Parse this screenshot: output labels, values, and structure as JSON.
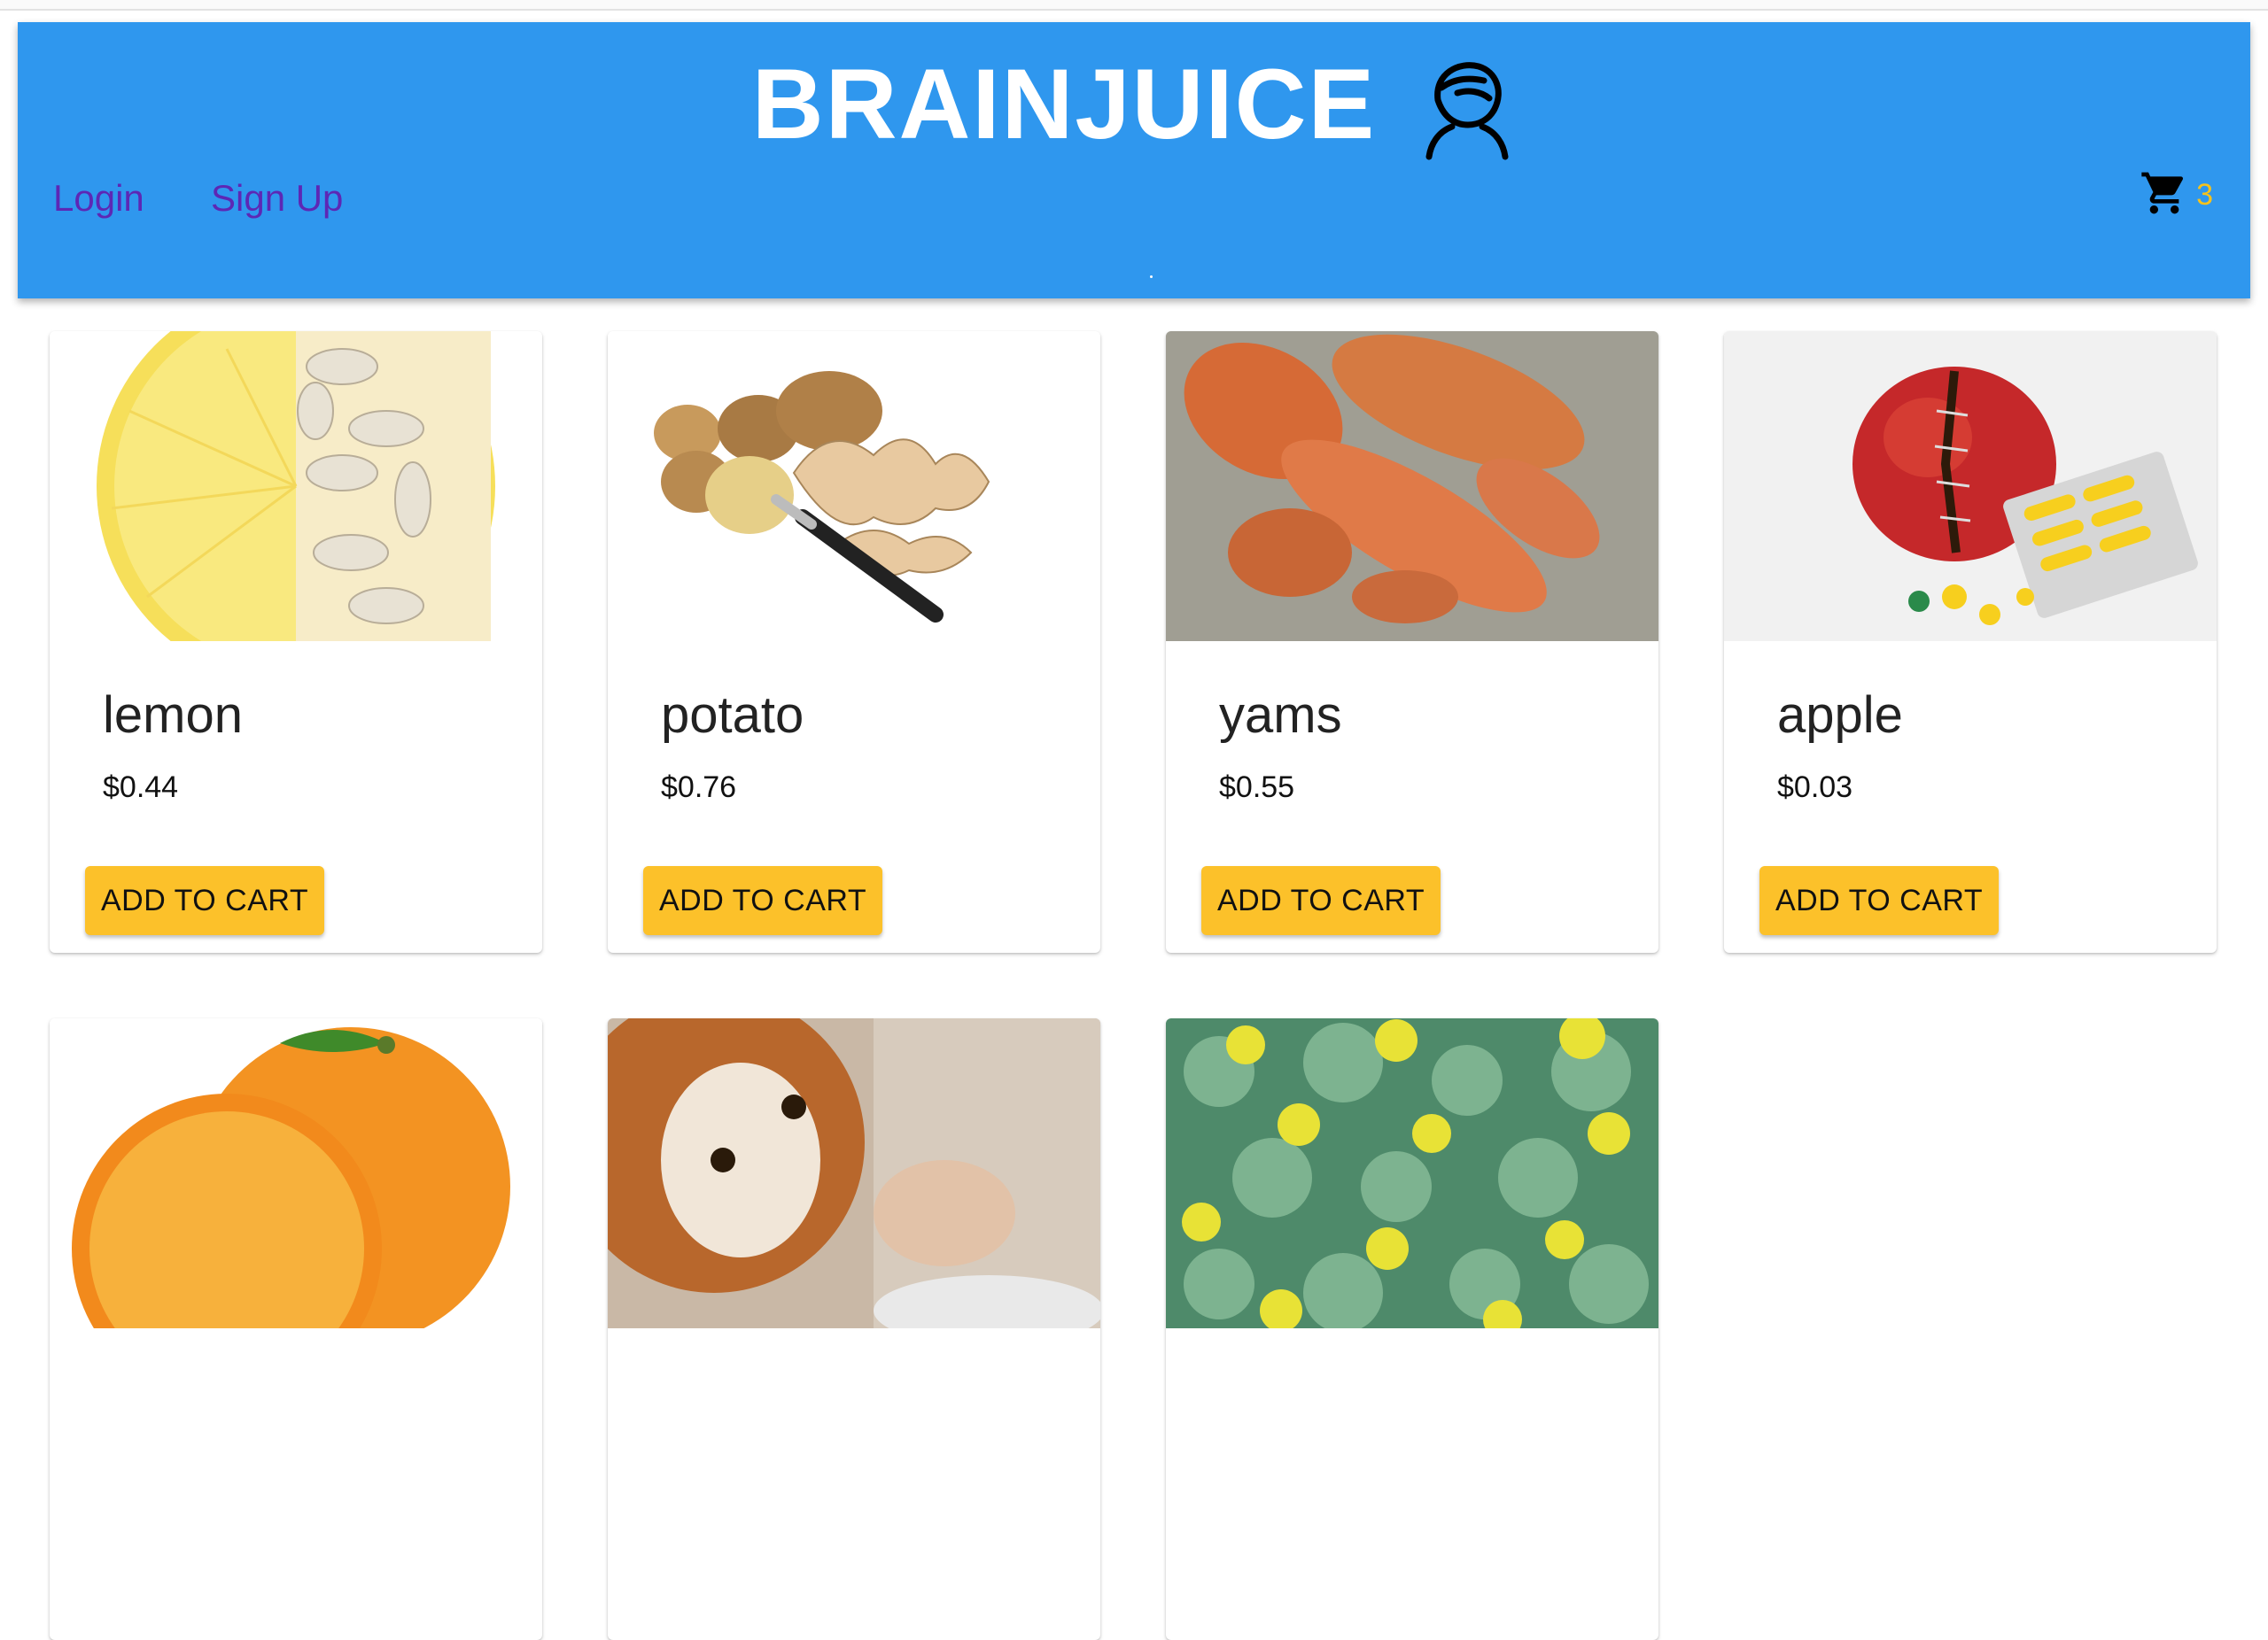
{
  "header": {
    "brand": "BRAINJUICE",
    "logo_icon": "head-silhouette-icon",
    "nav": {
      "login": "Login",
      "signup": "Sign Up"
    },
    "cart": {
      "icon": "shopping-cart-icon",
      "count": "3"
    }
  },
  "colors": {
    "appbar": "#2f97ee",
    "nav_link": "#5d27b5",
    "cart_count": "#f7c21b",
    "button": "#fcc12a"
  },
  "products": [
    {
      "name": "lemon",
      "price": "$0.44",
      "button": "ADD TO CART",
      "image": "lemon-with-pills-image"
    },
    {
      "name": "potato",
      "price": "$0.76",
      "button": "ADD TO CART",
      "image": "potatoes-and-peels-image"
    },
    {
      "name": "yams",
      "price": "$0.55",
      "button": "ADD TO CART",
      "image": "sweet-potatoes-image"
    },
    {
      "name": "apple",
      "price": "$0.03",
      "button": "ADD TO CART",
      "image": "apple-with-capsules-image"
    },
    {
      "name": "",
      "price": "",
      "button": "",
      "image": "orange-halves-image"
    },
    {
      "name": "",
      "price": "",
      "button": "",
      "image": "dog-drinking-image"
    },
    {
      "name": "",
      "price": "",
      "button": "",
      "image": "yellow-flowers-image"
    }
  ]
}
